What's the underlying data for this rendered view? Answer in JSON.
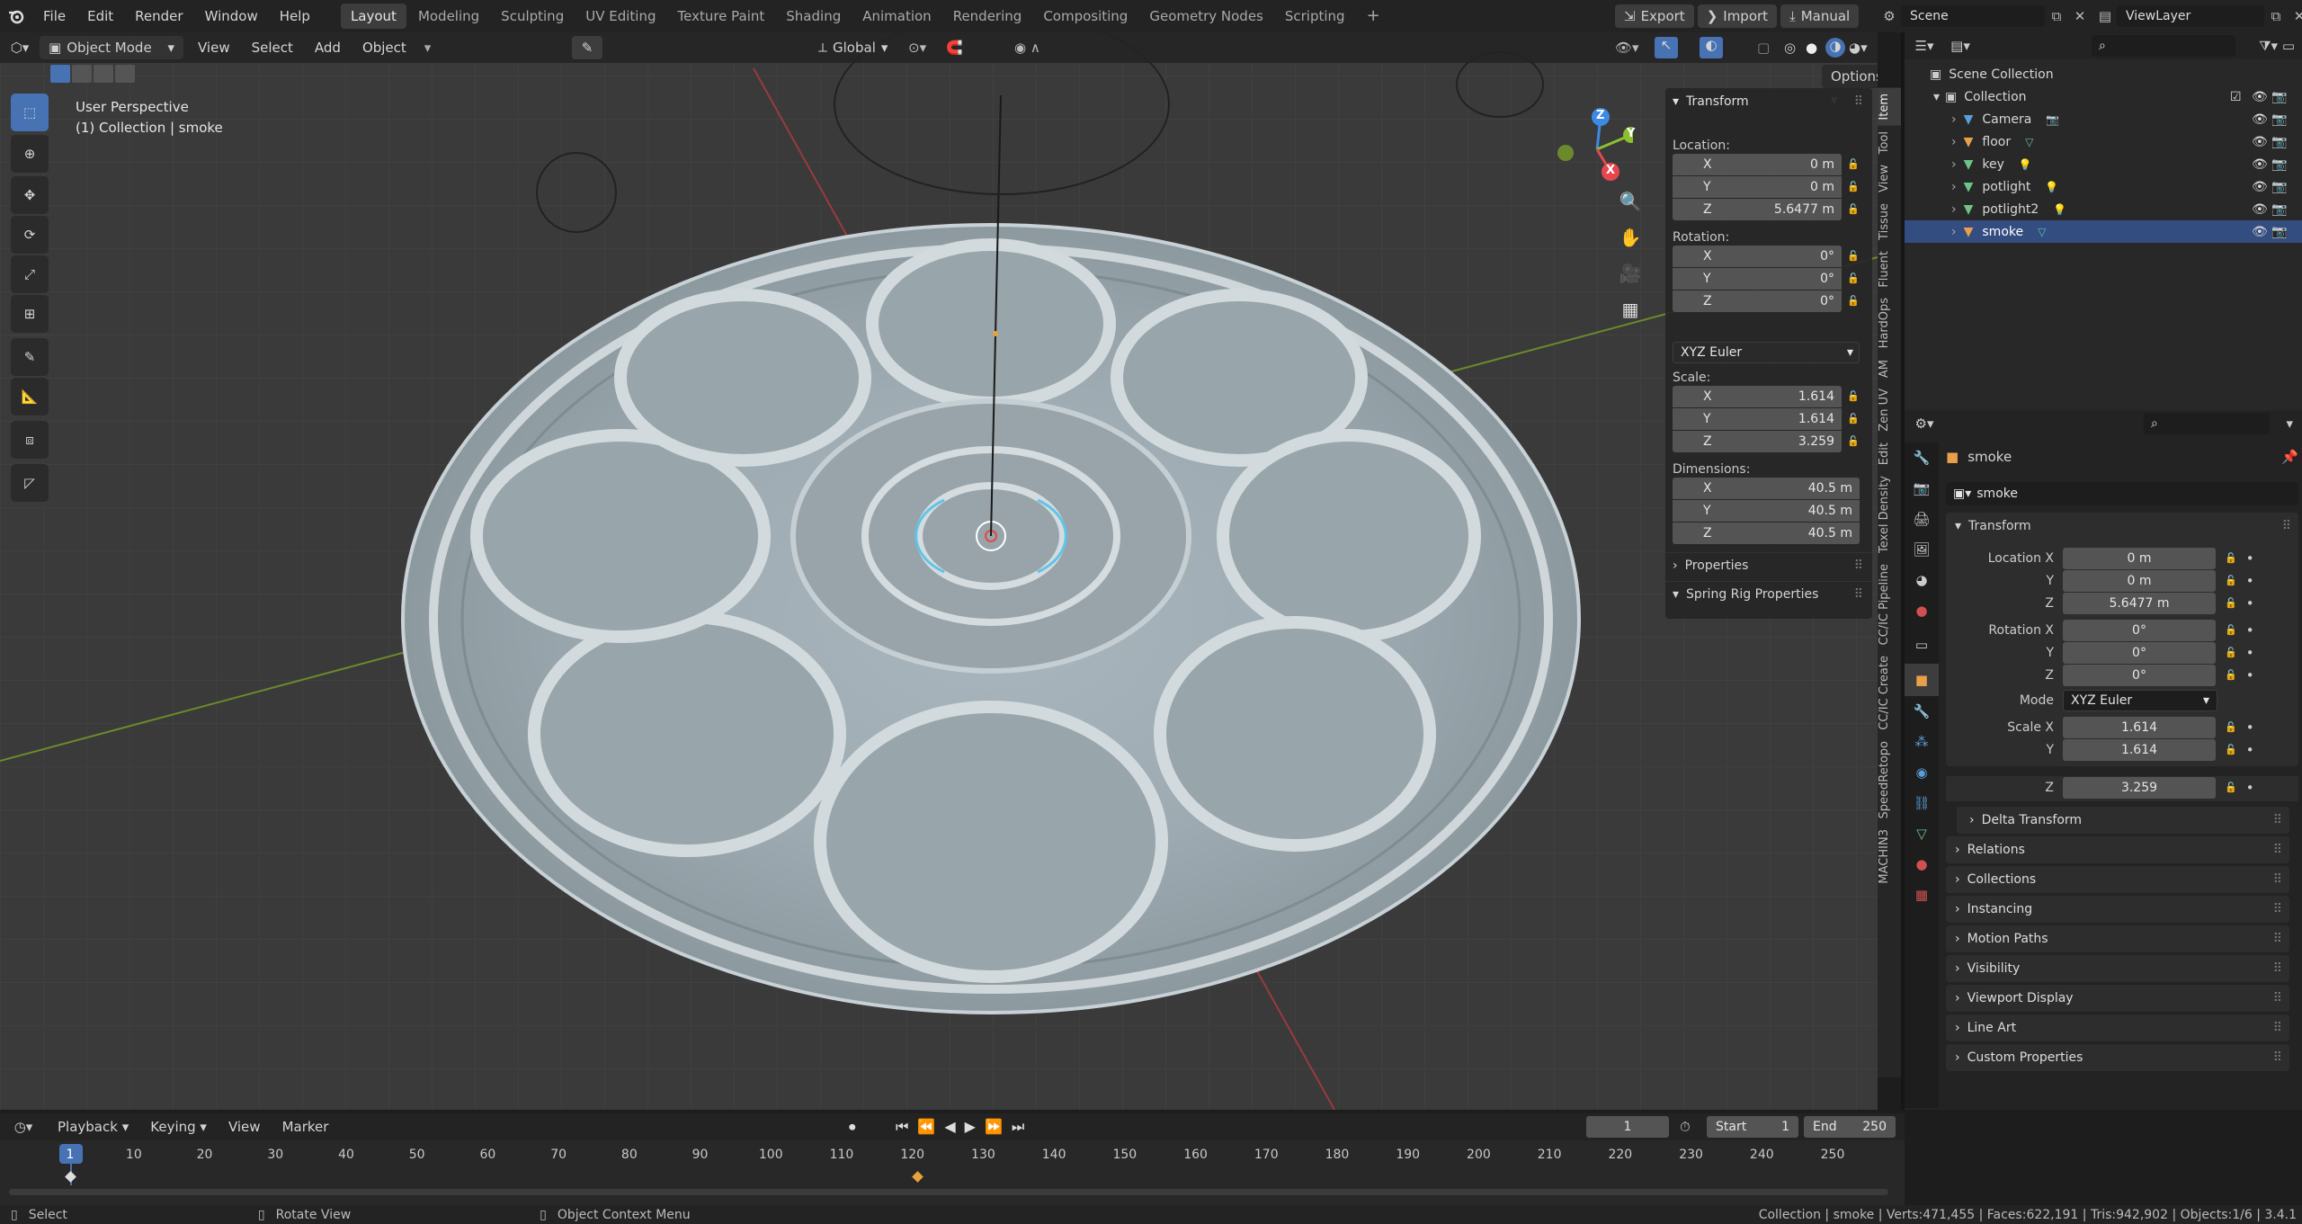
{
  "menubar": {
    "items": [
      "File",
      "Edit",
      "Render",
      "Window",
      "Help"
    ],
    "workspaces": [
      "Layout",
      "Modeling",
      "Sculpting",
      "UV Editing",
      "Texture Paint",
      "Shading",
      "Animation",
      "Rendering",
      "Compositing",
      "Geometry Nodes",
      "Scripting"
    ],
    "active_workspace": "Layout",
    "add_tab": "+",
    "export_label": "Export",
    "import_label": "Import",
    "manual_label": "Manual",
    "scene": "Scene",
    "view_layer": "ViewLayer"
  },
  "viewport_header": {
    "mode": "Object Mode",
    "menus": [
      "View",
      "Select",
      "Add",
      "Object"
    ],
    "orientation": "Global",
    "options": "Options"
  },
  "viewport": {
    "perspective": "User Perspective",
    "collection_info": "(1) Collection | smoke",
    "gizmo_axes": [
      "X",
      "Y",
      "Z"
    ]
  },
  "npanel": {
    "transform_title": "Transform",
    "location_label": "Location:",
    "location": [
      {
        "axis": "X",
        "value": "0 m"
      },
      {
        "axis": "Y",
        "value": "0 m"
      },
      {
        "axis": "Z",
        "value": "5.6477 m"
      }
    ],
    "rotation_label": "Rotation:",
    "rotation": [
      {
        "axis": "X",
        "value": "0°"
      },
      {
        "axis": "Y",
        "value": "0°"
      },
      {
        "axis": "Z",
        "value": "0°"
      }
    ],
    "rotation_mode": "XYZ Euler",
    "scale_label": "Scale:",
    "scale": [
      {
        "axis": "X",
        "value": "1.614"
      },
      {
        "axis": "Y",
        "value": "1.614"
      },
      {
        "axis": "Z",
        "value": "3.259"
      }
    ],
    "dimensions_label": "Dimensions:",
    "dimensions": [
      {
        "axis": "X",
        "value": "40.5 m"
      },
      {
        "axis": "Y",
        "value": "40.5 m"
      },
      {
        "axis": "Z",
        "value": "40.5 m"
      }
    ],
    "properties_label": "Properties",
    "spring_rig_label": "Spring Rig Properties",
    "tabs": [
      "Item",
      "Tool",
      "View",
      "Tissue",
      "Fluent",
      "HardOps",
      "AM",
      "Zen UV",
      "Edit",
      "Texel Density",
      "CC/IC Pipeline",
      "CC/IC Create",
      "SpeedRetopo",
      "MACHIN3"
    ]
  },
  "outliner": {
    "scene_collection": "Scene Collection",
    "collection": "Collection",
    "items": [
      {
        "name": "Camera",
        "icon": "camera-icon",
        "color": "#5a9fd8"
      },
      {
        "name": "floor",
        "icon": "mesh-icon",
        "color": "#e8a04a"
      },
      {
        "name": "key",
        "icon": "light-icon",
        "color": "#6dc486"
      },
      {
        "name": "potlight",
        "icon": "light-icon",
        "color": "#6dc486"
      },
      {
        "name": "potlight2",
        "icon": "light-icon",
        "color": "#6dc486"
      },
      {
        "name": "smoke",
        "icon": "mesh-icon",
        "color": "#e8a04a",
        "selected": true
      }
    ]
  },
  "properties": {
    "object_name": "smoke",
    "data_name": "smoke",
    "transform_title": "Transform",
    "location_x_label": "Location X",
    "location": [
      "0 m",
      "0 m",
      "5.6477 m"
    ],
    "rotation_x_label": "Rotation X",
    "rotation": [
      "0°",
      "0°",
      "0°"
    ],
    "mode_label": "Mode",
    "mode_value": "XYZ Euler",
    "scale_x_label": "Scale X",
    "scale": [
      "1.614",
      "1.614",
      "3.259"
    ],
    "y_label": "Y",
    "z_label": "Z",
    "delta_transform": "Delta Transform",
    "panels": [
      "Relations",
      "Collections",
      "Instancing",
      "Motion Paths",
      "Visibility",
      "Viewport Display",
      "Line Art",
      "Custom Properties"
    ]
  },
  "timeline": {
    "menus": [
      "Playback",
      "Keying",
      "View",
      "Marker"
    ],
    "current_frame": "1",
    "start_label": "Start",
    "start_value": "1",
    "end_label": "End",
    "end_value": "250",
    "ticks": [
      "1",
      "10",
      "20",
      "30",
      "40",
      "50",
      "60",
      "70",
      "80",
      "90",
      "100",
      "110",
      "120",
      "130",
      "140",
      "150",
      "160",
      "170",
      "180",
      "190",
      "200",
      "210",
      "220",
      "230",
      "240",
      "250"
    ]
  },
  "statusbar": {
    "select": "Select",
    "rotate_view": "Rotate View",
    "context_menu": "Object Context Menu",
    "stats": "Collection | smoke | Verts:471,455 | Faces:622,191 | Tris:942,902 | Objects:1/6 | 3.4.1"
  },
  "colors": {
    "accent": "#4772b3",
    "x_axis": "#e5474f",
    "y_axis": "#8bbf30",
    "z_axis": "#3c8ae6",
    "keyframe": "#e8a23d"
  }
}
